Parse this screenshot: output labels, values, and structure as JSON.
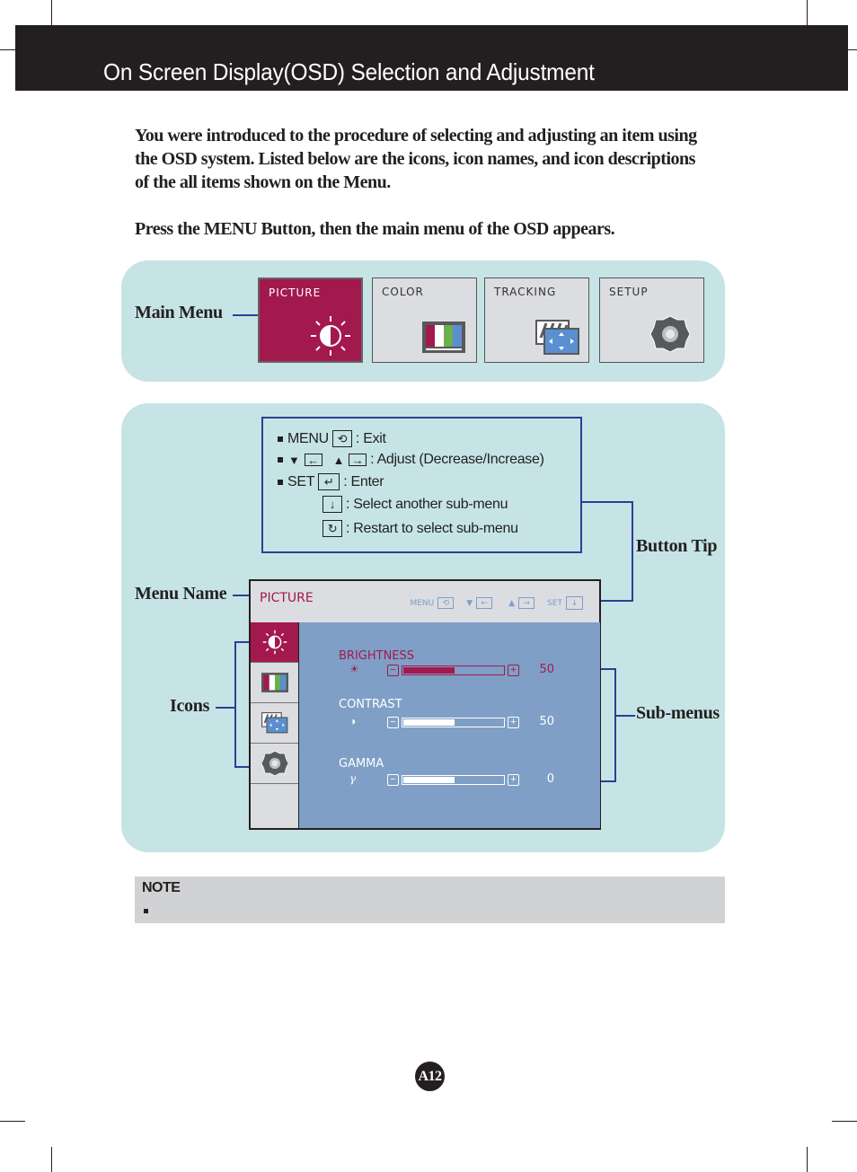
{
  "header": {
    "title": "On Screen Display(OSD) Selection and Adjustment"
  },
  "intro": {
    "paragraph1": "You were introduced to the procedure of selecting and adjusting an item using the OSD system.  Listed below are the icons, icon names, and icon descriptions of the all items shown on the Menu.",
    "paragraph2": "Press the MENU Button, then the main menu of the OSD appears."
  },
  "main_menu": {
    "label": "Main Menu",
    "tabs": [
      {
        "label": "PICTURE",
        "icon": "brightness-contrast-icon",
        "active": true
      },
      {
        "label": "COLOR",
        "icon": "color-bars-icon",
        "active": false
      },
      {
        "label": "TRACKING",
        "icon": "tracking-position-icon",
        "active": false
      },
      {
        "label": "SETUP",
        "icon": "gear-icon",
        "active": false
      }
    ]
  },
  "callouts": {
    "button_tip": "Button Tip",
    "menu_name": "Menu Name",
    "icons": "Icons",
    "sub_menus": "Sub-menus"
  },
  "button_tips": [
    {
      "key": "MENU",
      "icon": "exit-icon",
      "description": ": Exit"
    },
    {
      "key": "",
      "icon": "adjust-arrows-icon",
      "description": ": Adjust (Decrease/Increase)"
    },
    {
      "key": "SET",
      "icon": "enter-icon",
      "description": ": Enter"
    },
    {
      "key": "",
      "icon": "down-arrow-icon",
      "description": ": Select another sub-menu"
    },
    {
      "key": "",
      "icon": "restart-icon",
      "description": ": Restart to select sub-menu"
    }
  ],
  "osd": {
    "menu_name": "PICTURE",
    "tips": {
      "menu": "MENU",
      "set": "SET"
    },
    "submenus": [
      {
        "label": "BRIGHTNESS",
        "symbol": "☀",
        "value": "50",
        "fraction": 0.5,
        "active": true
      },
      {
        "label": "CONTRAST",
        "symbol": "◑",
        "value": "50",
        "fraction": 0.5,
        "active": false
      },
      {
        "label": "GAMMA",
        "symbol": "γ",
        "value": "0",
        "fraction": 0.5,
        "active": false
      }
    ]
  },
  "note": {
    "title": "NOTE"
  },
  "page": {
    "number": "A12"
  },
  "colors": {
    "accent": "#a3194e",
    "panel": "#c6e4e6",
    "osd_main": "#7f9fc6",
    "callout_line": "#2b3f93",
    "header_bg": "#231f20"
  }
}
